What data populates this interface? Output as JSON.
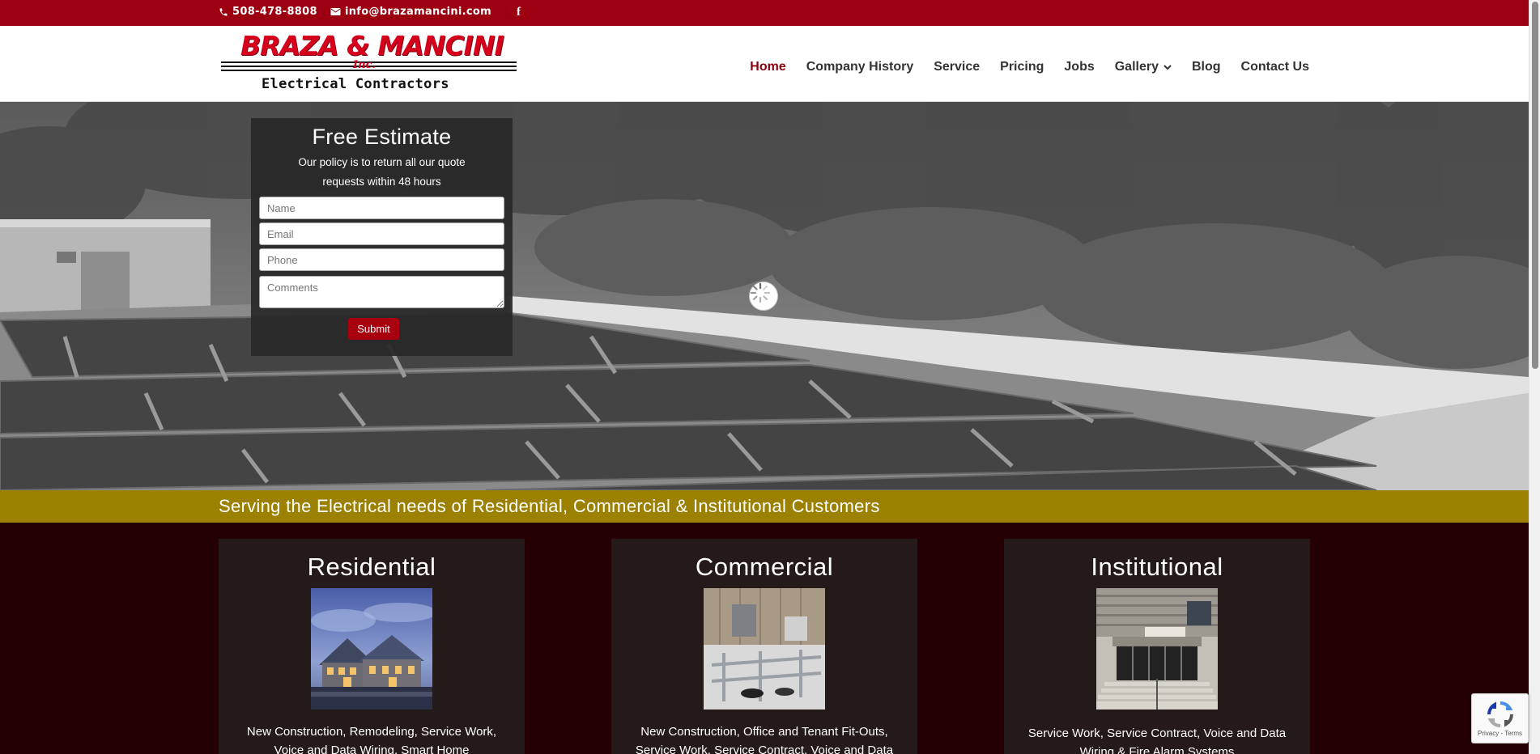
{
  "topbar": {
    "phone": "508-478-8808",
    "email": "info@brazamancini.com",
    "facebook_icon": "f"
  },
  "logo": {
    "name": "BRAZA & MANCINI",
    "inc": "Inc.",
    "tagline": "Electrical Contractors"
  },
  "nav": {
    "items": [
      {
        "label": "Home",
        "active": true
      },
      {
        "label": "Company History"
      },
      {
        "label": "Service"
      },
      {
        "label": "Pricing"
      },
      {
        "label": "Jobs"
      },
      {
        "label": "Gallery",
        "has_dropdown": true
      },
      {
        "label": "Blog"
      },
      {
        "label": "Contact Us"
      }
    ]
  },
  "estimate": {
    "title": "Free Estimate",
    "text": "Our policy is to return all our quote requests within 48 hours",
    "name_placeholder": "Name",
    "email_placeholder": "Email",
    "phone_placeholder": "Phone",
    "comments_placeholder": "Comments",
    "submit_label": "Submit"
  },
  "band": {
    "text": "Serving the Electrical needs of Residential, Commercial & Institutional Customers"
  },
  "cards": [
    {
      "title": "Residential",
      "text": "New Construction, Remodeling, Service Work, Voice and Data Wiring, Smart Home"
    },
    {
      "title": "Commercial",
      "text": "New Construction, Office and Tenant Fit-Outs, Service Work, Service Contract, Voice and Data"
    },
    {
      "title": "Institutional",
      "text": "Service Work, Service Contract, Voice and Data Wiring & Fire Alarm Systems"
    }
  ],
  "recaptcha": {
    "links": "Privacy - Terms"
  },
  "colors": {
    "topbar": "#9c0010",
    "accent_band": "#9c8000",
    "page_bg": "#240004",
    "card_bg": "#251a1a",
    "submit": "#a8000f"
  }
}
